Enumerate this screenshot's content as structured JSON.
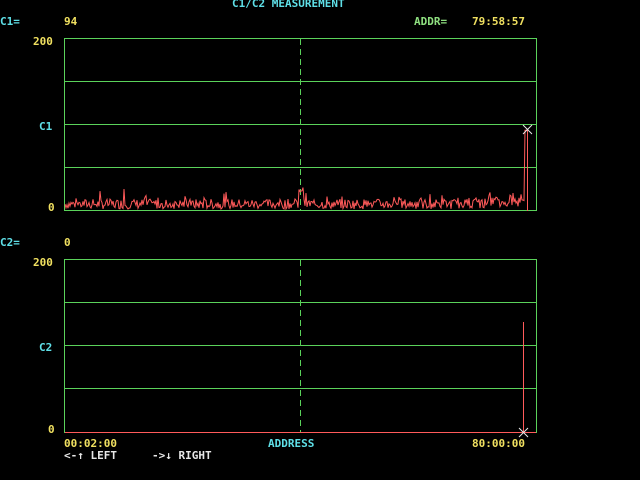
{
  "title": "C1/C2 MEASUREMENT",
  "c1": {
    "label": "C1=",
    "value": "94"
  },
  "addr": {
    "label": "ADDR=",
    "value": "79:58:57"
  },
  "c2": {
    "label": "C2=",
    "value": "0"
  },
  "chart1": {
    "ymax": "200",
    "ymid": "C1",
    "ymin": "0"
  },
  "chart2": {
    "ymax": "200",
    "ymid": "C2",
    "ymin": "0"
  },
  "xaxis": {
    "start": "00:02:00",
    "label": "ADDRESS",
    "end": "80:00:00"
  },
  "hints": {
    "left": "<-↑ LEFT",
    "right": "->↓ RIGHT"
  },
  "colors": {
    "grid": "#5ad25a",
    "trace": "#ff5a5a",
    "marker": "#e8e8e8",
    "label_cyan": "#5fe0e8",
    "value_yellow": "#f0e060"
  },
  "chart_data": [
    {
      "type": "line",
      "series": [
        {
          "name": "C1",
          "values": "noise 0-30 across ADDRESS, spike to ~30 near center, spike to ~94 at right end"
        }
      ],
      "ylim": [
        0,
        200
      ],
      "cursor_value": 94
    },
    {
      "type": "line",
      "series": [
        {
          "name": "C2",
          "values": "flat 0 across ADDRESS with single spike to ~130 near right end"
        }
      ],
      "ylim": [
        0,
        200
      ],
      "cursor_value": 0
    }
  ]
}
